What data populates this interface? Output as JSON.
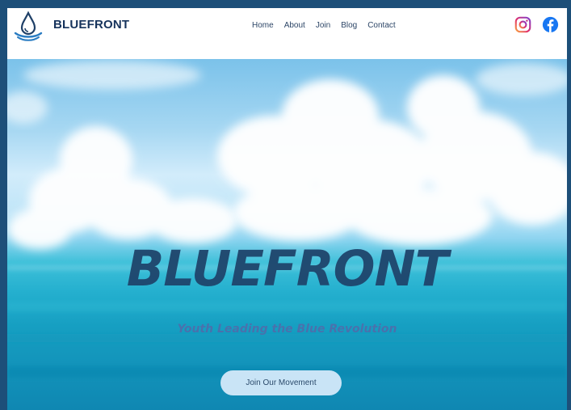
{
  "header": {
    "brand": "BLUEFRONT",
    "logo_icon": "water-drop-logo-icon",
    "nav": [
      {
        "label": "Home"
      },
      {
        "label": "About"
      },
      {
        "label": "Join"
      },
      {
        "label": "Blog"
      },
      {
        "label": "Contact"
      }
    ],
    "social": [
      {
        "icon": "instagram-icon",
        "color": "#e1306c"
      },
      {
        "icon": "facebook-icon",
        "color": "#1877f2"
      }
    ]
  },
  "hero": {
    "title": "BLUEFRONT",
    "subtitle": "Youth Leading the Blue Revolution",
    "cta_label": "Join Our Movement"
  },
  "colors": {
    "page_border": "#1d4f79",
    "brand_navy": "#16335c",
    "title": "#1f456c",
    "button_bg": "#c9e4f6"
  }
}
